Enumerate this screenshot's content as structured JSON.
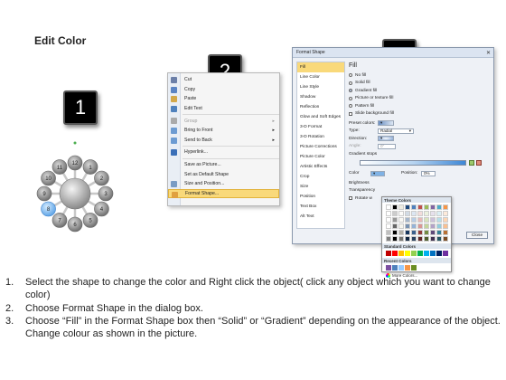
{
  "title": "Edit Color",
  "steps": [
    "1",
    "2",
    "3"
  ],
  "diagram": {
    "numbers": [
      "1",
      "2",
      "3",
      "4",
      "5",
      "6",
      "7",
      "8",
      "9",
      "10",
      "11",
      "12"
    ]
  },
  "context_menu": {
    "items": [
      {
        "label": "Cut",
        "disabled": false,
        "icon": "scissors-icon"
      },
      {
        "label": "Copy",
        "disabled": false,
        "icon": "copy-icon"
      },
      {
        "label": "Paste",
        "disabled": false,
        "icon": "paste-icon"
      },
      {
        "label": "Edit Text",
        "disabled": false,
        "icon": "edit-text-icon"
      },
      {
        "label": "Group",
        "disabled": true,
        "icon": "group-icon",
        "submenu": true
      },
      {
        "label": "Bring to Front",
        "disabled": false,
        "icon": "bring-front-icon",
        "submenu": true
      },
      {
        "label": "Send to Back",
        "disabled": false,
        "icon": "send-back-icon",
        "submenu": true
      },
      {
        "label": "Hyperlink...",
        "disabled": false,
        "icon": "hyperlink-icon"
      },
      {
        "label": "Save as Picture...",
        "disabled": false,
        "icon": ""
      },
      {
        "label": "Set as Default Shape",
        "disabled": false,
        "icon": ""
      },
      {
        "label": "Size and Position...",
        "disabled": false,
        "icon": "size-icon"
      },
      {
        "label": "Format Shape...",
        "disabled": false,
        "icon": "format-shape-icon",
        "highlighted": true
      }
    ]
  },
  "format_dialog": {
    "title": "Format Shape",
    "close": "✕",
    "categories": [
      "Fill",
      "Line Color",
      "Line Style",
      "Shadow",
      "Reflection",
      "Glow and Soft Edges",
      "3-D Format",
      "3-D Rotation",
      "Picture Corrections",
      "Picture Color",
      "Artistic Effects",
      "Crop",
      "Size",
      "Position",
      "Text Box",
      "Alt Text"
    ],
    "heading": "Fill",
    "fill_options": [
      "No fill",
      "Solid fill",
      "Gradient fill",
      "Picture or texture fill",
      "Pattern fill",
      "Slide background fill"
    ],
    "preset_colors_label": "Preset colors:",
    "type_label": "Type:",
    "type_value": "Radial",
    "direction_label": "Direction:",
    "angle_label": "Angle:",
    "angle_value": "0°",
    "gradient_stops_label": "Gradient stops",
    "color_label": "Color",
    "position_label": "Position:",
    "position_value": "0%",
    "brightness_label": "Brightness",
    "transparency_label": "Transparency",
    "rotate_label": "Rotate w",
    "close_button": "Close"
  },
  "palette": {
    "theme_label": "Theme Colors",
    "standard_label": "Standard Colors",
    "recent_label": "Recent Colors",
    "more_label": "More Colors...",
    "theme_top": [
      "#ffffff",
      "#000000",
      "#eeece1",
      "#1f497d",
      "#4f81bd",
      "#c0504d",
      "#9bbb59",
      "#8064a2",
      "#4bacc6",
      "#f79646"
    ],
    "standard": [
      "#c00000",
      "#ff0000",
      "#ffc000",
      "#ffff00",
      "#92d050",
      "#00b050",
      "#00b0f0",
      "#0070c0",
      "#002060",
      "#7030a0"
    ],
    "recent": [
      "#7b4ea1",
      "#4f81bd",
      "#99ccff",
      "#f79646",
      "#6b8e23"
    ]
  },
  "instructions": [
    {
      "num": "1.",
      "text": "Select the shape to change the color and Right click the object( click any object which you want to change color)"
    },
    {
      "num": "2.",
      "text": "Choose Format Shape in the dialog box."
    },
    {
      "num": "3.",
      "text": "Choose “Fill” in the Format Shape box then “Solid” or “Gradient” depending on the appearance of the object. Change colour as shown in the picture."
    }
  ]
}
